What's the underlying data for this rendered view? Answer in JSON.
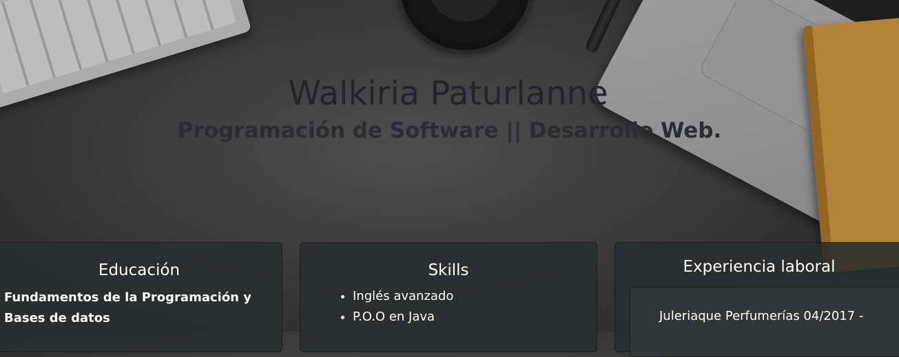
{
  "header": {
    "name": "Walkiria Paturlanne",
    "subtitle": "Programación de Software || Desarrollo Web."
  },
  "education": {
    "title": "Educación",
    "items": [
      "Fundamentos de la Programación y Bases de datos"
    ]
  },
  "skills": {
    "title": "Skills",
    "items": [
      "Inglés avanzado",
      "P.O.O en Java"
    ]
  },
  "experience": {
    "title": "Experiencia laboral",
    "jobs": [
      "Juleriaque Perfumerías 04/2017 -"
    ]
  }
}
